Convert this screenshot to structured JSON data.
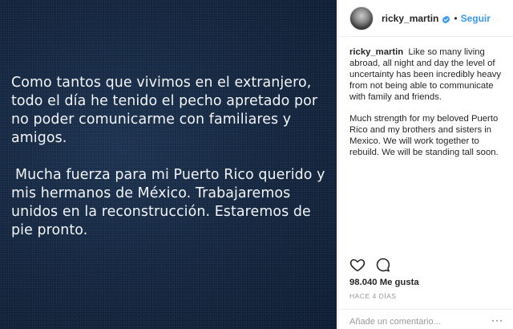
{
  "post_image": {
    "paragraph1": "Como tantos que vivimos en el extranjero, todo el día he tenido el pecho apretado por no poder comunicarme con familiares y amigos.",
    "paragraph2": "Mucha fuerza para mi Puerto Rico querido y mis hermanos de México. Trabajaremos unidos en la reconstrucción. Estaremos de pie pronto."
  },
  "header": {
    "username": "ricky_martin",
    "separator": "•",
    "follow_label": "Seguir"
  },
  "caption": {
    "username": "ricky_martin",
    "paragraph1": "Like so many living abroad, all night and day the level of uncertainty has been incredibly heavy from not being able to communicate with family and friends.",
    "paragraph2": "Much strength for my beloved Puerto Rico and my brothers and sisters in Mexico. We will work together to rebuild. We will be standing tall soon."
  },
  "stats": {
    "likes": "98.040 Me gusta",
    "time": "HACE 4 DÍAS"
  },
  "comment": {
    "placeholder": "Añade un comentario...",
    "more": "···"
  },
  "icons": {
    "like": "heart-icon",
    "comment": "comment-icon",
    "verified": "verified-badge-icon",
    "more": "more-options-icon"
  },
  "colors": {
    "accent": "#3897f0",
    "post_background": "#152842",
    "text": "#262626",
    "muted": "#999999"
  }
}
